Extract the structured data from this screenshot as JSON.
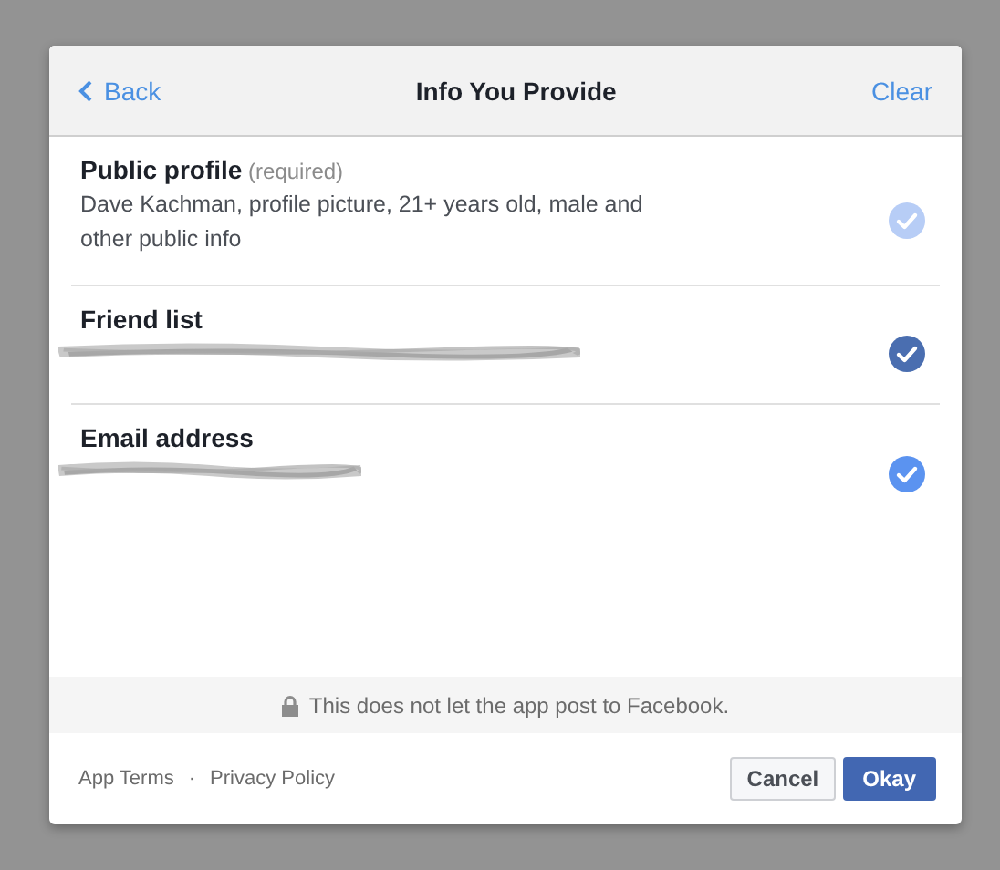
{
  "header": {
    "back": "Back",
    "title": "Info You Provide",
    "clear": "Clear"
  },
  "permissions": [
    {
      "name": "Public profile",
      "note": "(required)",
      "kind": "text",
      "detail": "Dave Kachman, profile picture, 21+ years old, male and other public info",
      "checked": true,
      "disabled": true,
      "hovered": false
    },
    {
      "name": "Friend list",
      "kind": "redacted",
      "checked": true,
      "disabled": false,
      "hovered": true
    },
    {
      "name": "Email address",
      "kind": "redacted",
      "checked": true,
      "disabled": false,
      "hovered": false
    }
  ],
  "notice": "This does not let the app post to Facebook.",
  "footer": {
    "links": [
      "App Terms",
      "Privacy Policy"
    ],
    "separator": "·",
    "cancel": "Cancel",
    "okay": "Okay"
  }
}
